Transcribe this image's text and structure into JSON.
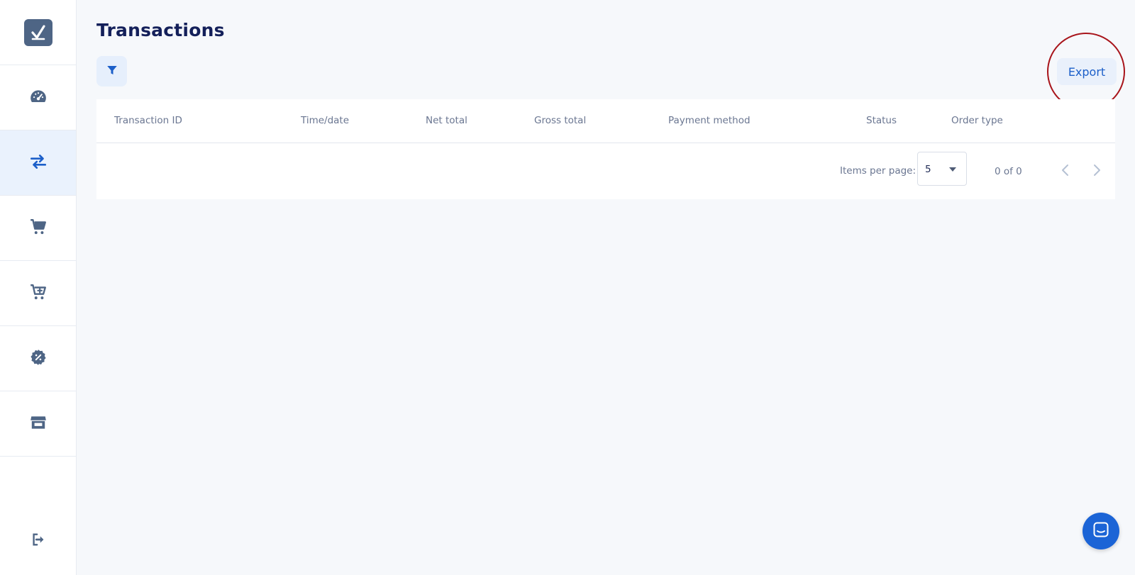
{
  "app": {
    "logo_icon": "checkmark-logo-icon",
    "accent_color": "#1c5fc9"
  },
  "sidebar": {
    "items": [
      {
        "icon": "dashboard-gauge-icon",
        "active": false
      },
      {
        "icon": "transfer-arrows-icon",
        "active": true
      },
      {
        "icon": "shopping-cart-icon",
        "active": false
      },
      {
        "icon": "add-to-cart-icon",
        "active": false
      },
      {
        "icon": "discount-badge-icon",
        "active": false
      },
      {
        "icon": "store-icon",
        "active": false
      }
    ],
    "logout_icon": "logout-icon"
  },
  "page": {
    "title": "Transactions"
  },
  "toolbar": {
    "filter_icon": "filter-icon",
    "export_label": "Export"
  },
  "table": {
    "columns": [
      "Transaction ID",
      "Time/date",
      "Net total",
      "Gross total",
      "Payment method",
      "Status",
      "Order type"
    ],
    "rows": []
  },
  "pagination": {
    "items_per_page_label": "Items per page:",
    "items_per_page_value": "5",
    "range_label": "0 of 0"
  },
  "chat": {
    "icon": "chat-icon"
  }
}
